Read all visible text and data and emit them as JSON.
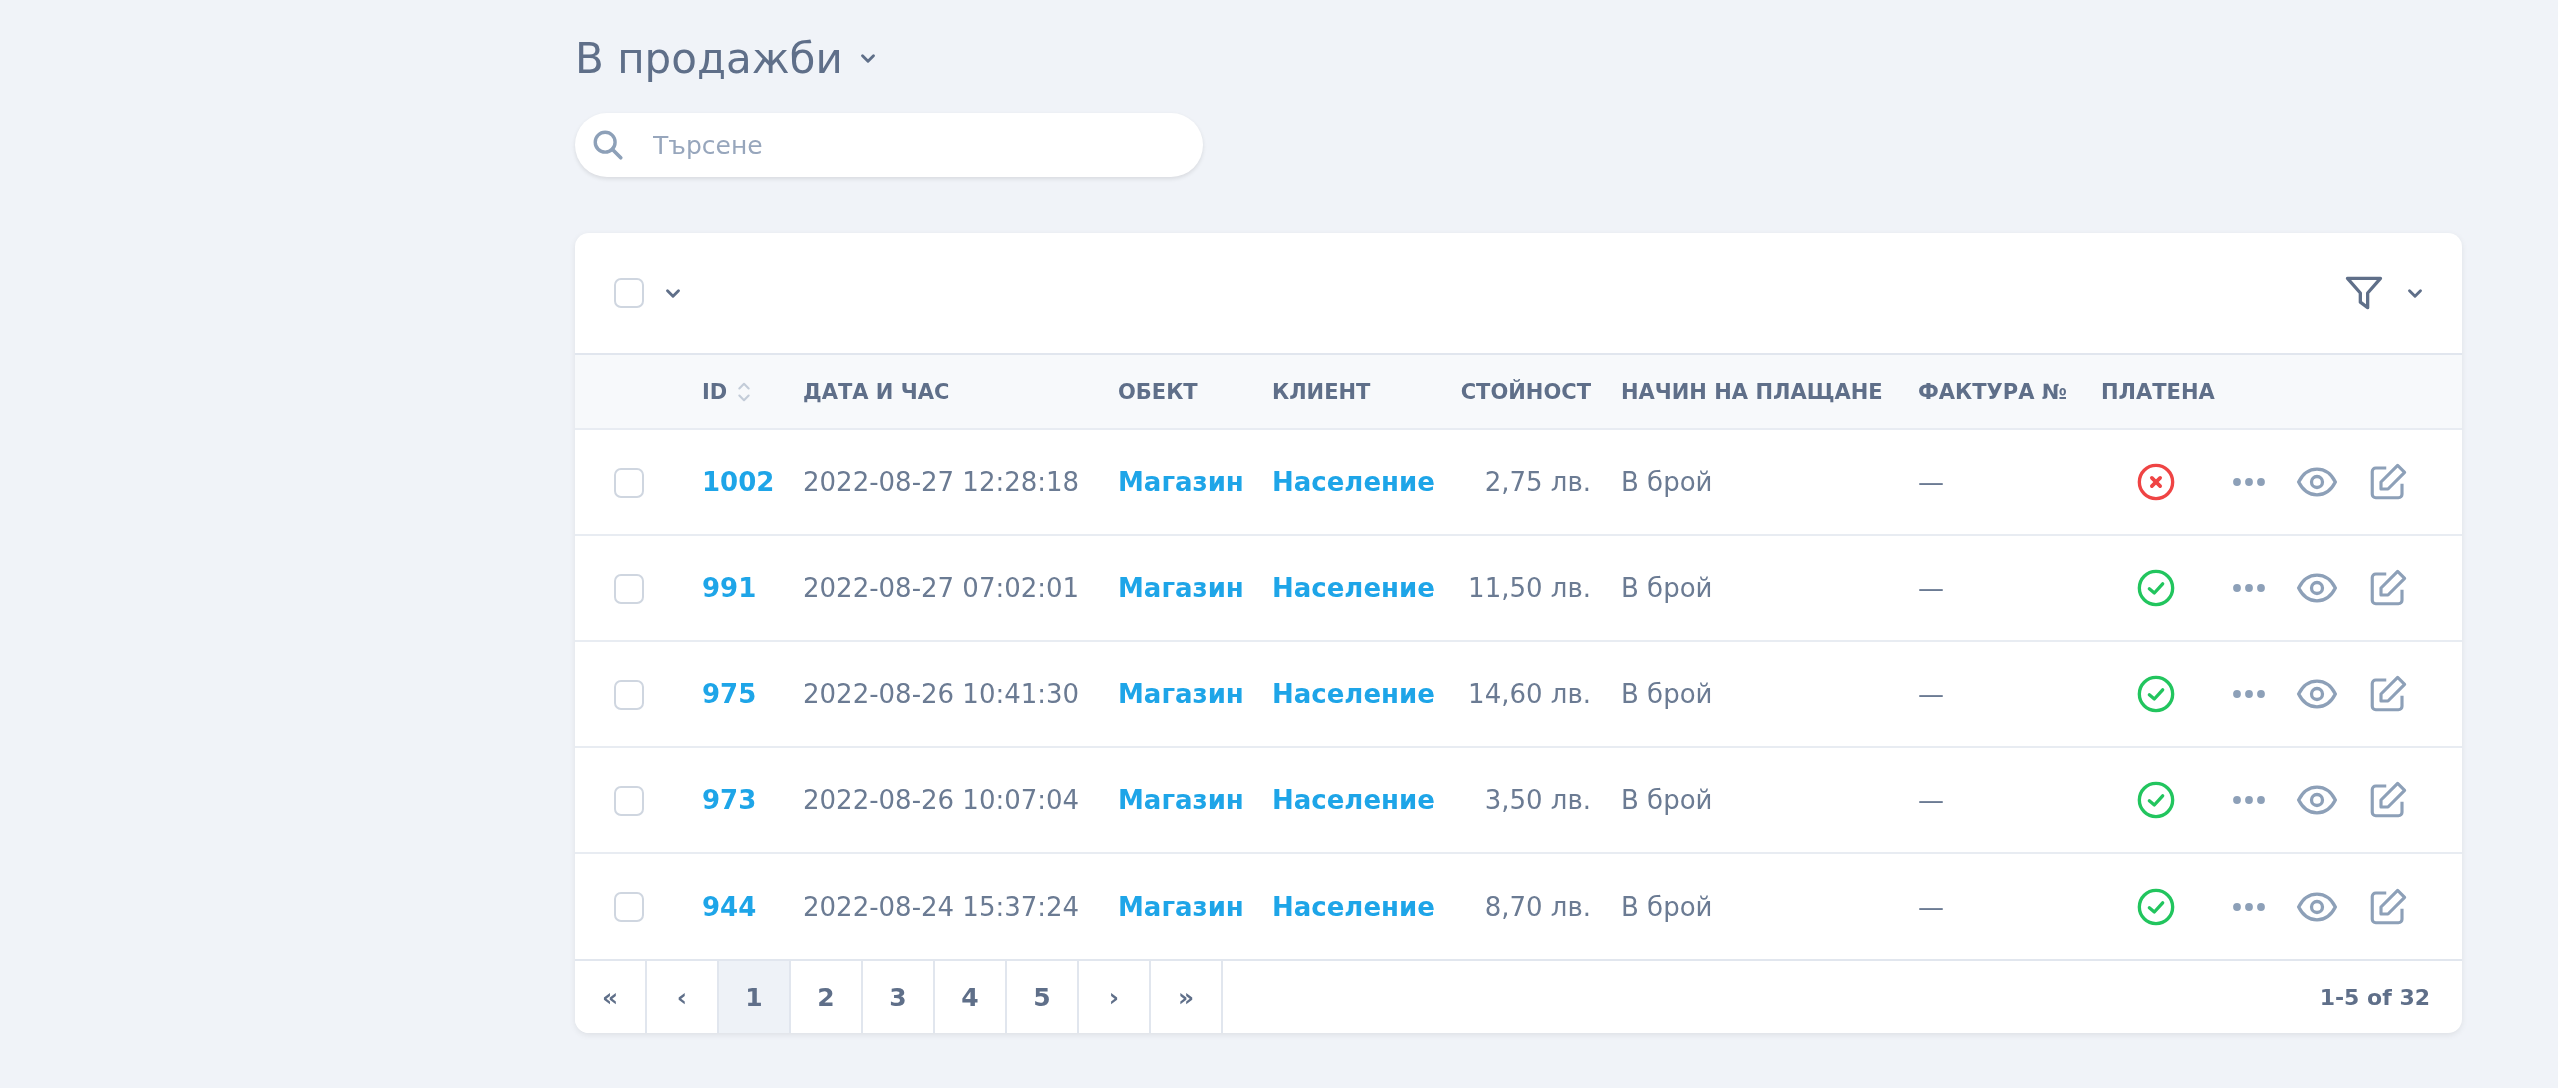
{
  "title": "В продажби",
  "search": {
    "placeholder": "Търсене"
  },
  "select_all": {
    "checked": false
  },
  "table": {
    "columns": [
      {
        "label": "ID",
        "sortable": true
      },
      {
        "label": "ДАТА И ЧАС",
        "sortable": false
      },
      {
        "label": "ОБЕКТ",
        "sortable": false
      },
      {
        "label": "КЛИЕНТ",
        "sortable": false
      },
      {
        "label": "СТОЙНОСТ",
        "sortable": false
      },
      {
        "label": "НАЧИН НА ПЛАЩАНЕ",
        "sortable": false
      },
      {
        "label": "ФАКТУРА №",
        "sortable": false
      },
      {
        "label": "ПЛАТЕНА",
        "sortable": false
      }
    ],
    "rows": [
      {
        "checked": false,
        "id": "1002",
        "datetime": "2022-08-27 12:28:18",
        "object": "Магазин",
        "client": "Население",
        "amount": "2,75 лв.",
        "payment": "В брой",
        "invoice": "—",
        "paid": false
      },
      {
        "checked": false,
        "id": "991",
        "datetime": "2022-08-27 07:02:01",
        "object": "Магазин",
        "client": "Население",
        "amount": "11,50 лв.",
        "payment": "В брой",
        "invoice": "—",
        "paid": true
      },
      {
        "checked": false,
        "id": "975",
        "datetime": "2022-08-26 10:41:30",
        "object": "Магазин",
        "client": "Население",
        "amount": "14,60 лв.",
        "payment": "В брой",
        "invoice": "—",
        "paid": true
      },
      {
        "checked": false,
        "id": "973",
        "datetime": "2022-08-26 10:07:04",
        "object": "Магазин",
        "client": "Население",
        "amount": "3,50 лв.",
        "payment": "В брой",
        "invoice": "—",
        "paid": true
      },
      {
        "checked": false,
        "id": "944",
        "datetime": "2022-08-24 15:37:24",
        "object": "Магазин",
        "client": "Население",
        "amount": "8,70 лв.",
        "payment": "В брой",
        "invoice": "—",
        "paid": true
      }
    ]
  },
  "pagination": {
    "pages": [
      {
        "label": "«",
        "selected": false
      },
      {
        "label": "‹",
        "selected": false
      },
      {
        "label": "1",
        "selected": true
      },
      {
        "label": "2",
        "selected": false
      },
      {
        "label": "3",
        "selected": false
      },
      {
        "label": "4",
        "selected": false
      },
      {
        "label": "5",
        "selected": false
      },
      {
        "label": "›",
        "selected": false
      },
      {
        "label": "»",
        "selected": false
      }
    ],
    "summary": "1-5 of 32"
  }
}
